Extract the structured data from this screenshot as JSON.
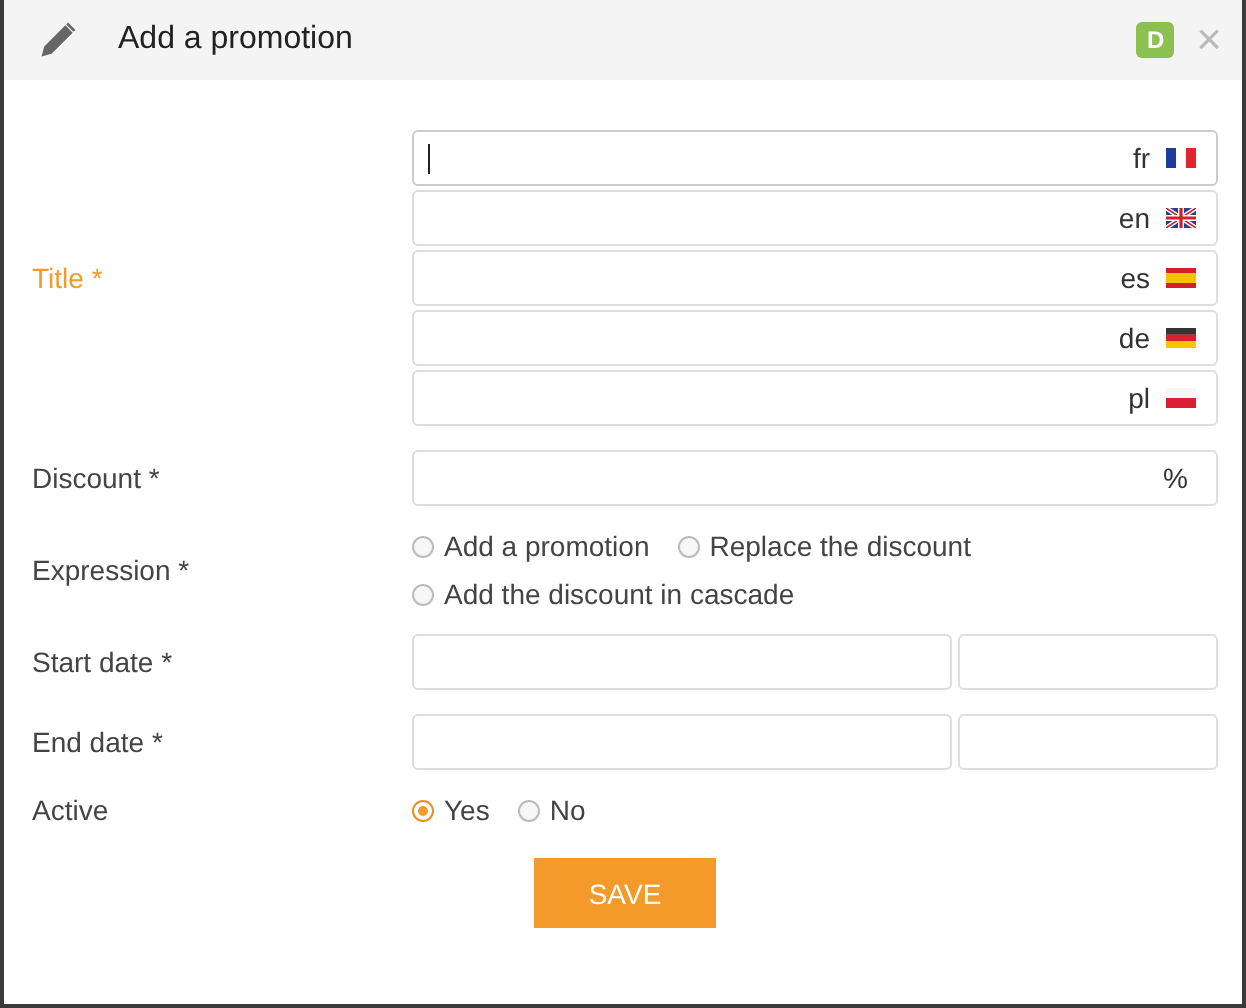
{
  "window": {
    "title": "Add a promotion",
    "badge": "D",
    "close": "×"
  },
  "title_field": {
    "label": "Title *",
    "focused": true,
    "languages": [
      {
        "code": "fr",
        "focused": true
      },
      {
        "code": "en",
        "focused": false
      },
      {
        "code": "es",
        "focused": false
      },
      {
        "code": "de",
        "focused": false
      },
      {
        "code": "pl",
        "focused": false
      }
    ]
  },
  "discount": {
    "label": "Discount *",
    "unit": "%"
  },
  "expression": {
    "label": "Expression *",
    "options": [
      {
        "label": "Add a promotion",
        "selected": false
      },
      {
        "label": "Replace the discount",
        "selected": false
      },
      {
        "label": "Add the discount in cascade",
        "selected": false
      }
    ]
  },
  "dates": [
    {
      "label": "Start date *"
    },
    {
      "label": "End date *"
    }
  ],
  "active": {
    "label": "Active",
    "options": [
      {
        "label": "Yes",
        "selected": true
      },
      {
        "label": "No",
        "selected": false
      }
    ]
  },
  "save_button": "SAVE"
}
